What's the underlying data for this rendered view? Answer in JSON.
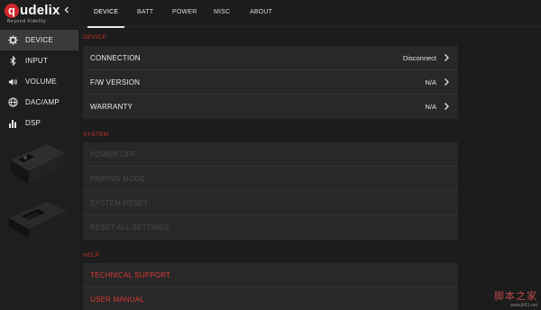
{
  "brand": {
    "logo_letter": "q",
    "logo_text": "udelix",
    "tagline": "Beyond Fidelity"
  },
  "sidebar": {
    "collapse_icon": "chevron-left-icon",
    "items": [
      {
        "label": "DEVICE",
        "icon": "gear-icon",
        "active": true
      },
      {
        "label": "INPUT",
        "icon": "bluetooth-icon",
        "active": false
      },
      {
        "label": "VOLUME",
        "icon": "speaker-icon",
        "active": false
      },
      {
        "label": "DAC/AMP",
        "icon": "globe-icon",
        "active": false
      },
      {
        "label": "DSP",
        "icon": "bars-icon",
        "active": false
      }
    ]
  },
  "tabs": [
    {
      "label": "DEVICE",
      "active": true
    },
    {
      "label": "BATT",
      "active": false
    },
    {
      "label": "POWER",
      "active": false
    },
    {
      "label": "MISC",
      "active": false
    },
    {
      "label": "ABOUT",
      "active": false
    }
  ],
  "sections": {
    "device": {
      "title": "DEVICE",
      "rows": [
        {
          "label": "CONNECTION",
          "value": "Disconnect"
        },
        {
          "label": "F/W VERSION",
          "value": "N/A"
        },
        {
          "label": "WARRANTY",
          "value": "N/A"
        }
      ]
    },
    "system": {
      "title": "SYSTEM",
      "rows": [
        {
          "label": "POWER OFF"
        },
        {
          "label": "PAIRING MODE"
        },
        {
          "label": "SYSTEM RESET"
        },
        {
          "label": "RESET ALL SETTINGS"
        }
      ]
    },
    "help": {
      "title": "HELP",
      "rows": [
        {
          "label": "TECHNICAL SUPPORT"
        },
        {
          "label": "USER MANUAL"
        }
      ]
    }
  },
  "colors": {
    "accent_red": "#c8302b",
    "background": "#1d1d1d",
    "panel": "#282828"
  },
  "watermark": {
    "line1": "脚本之家",
    "line2": "www.jb51.net"
  }
}
